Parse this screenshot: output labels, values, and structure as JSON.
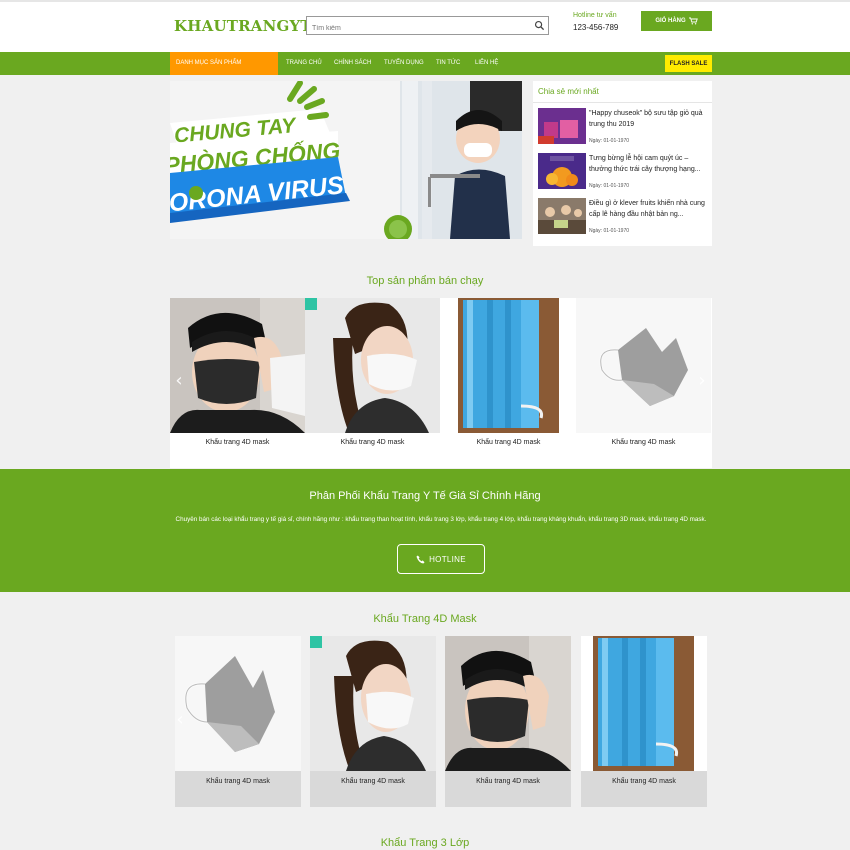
{
  "header": {
    "logo": "KHAUTRANGYTE",
    "search_placeholder": "Tìm kiếm",
    "hotline_label": "Hotline tư vấn",
    "hotline_number": "123-456-789",
    "cart_label": "GIỎ HÀNG"
  },
  "nav": {
    "category_label": "DANH MỤC SẢN PHẨM",
    "items": [
      "TRANG CHỦ",
      "CHÍNH SÁCH",
      "TUYỂN DỤNG",
      "TIN TỨC",
      "LIÊN HỆ"
    ],
    "flash_sale": "FLASH SALE"
  },
  "banner": {
    "line1": "CHUNG TAY",
    "line2": "PHÒNG CHỐNG",
    "line3": "CORONA VIRUS"
  },
  "news": {
    "title": "Chia sẻ mới nhất",
    "items": [
      {
        "title": "\"Happy chuseok\" bộ sưu tập giỏ quà trung thu 2019",
        "date": "Ngày: 01-01-1970"
      },
      {
        "title": "Tưng bừng lễ hội cam quýt úc – thưởng thức trái cây thượng hạng...",
        "date": "Ngày: 01-01-1970"
      },
      {
        "title": "Điều gì ở klever fruits khiến nhà cung cấp lê hàng đầu nhật bản ng...",
        "date": "Ngày: 01-01-1970"
      }
    ]
  },
  "bestsellers": {
    "title": "Top sản phẩm bán chạy",
    "products": [
      {
        "name": "Khẩu trang 4D mask",
        "image": "black-mask-person"
      },
      {
        "name": "Khẩu trang 4D mask",
        "image": "white-mask-woman"
      },
      {
        "name": "Khẩu trang 4D mask",
        "image": "blue-surgical-mask"
      },
      {
        "name": "Khẩu trang 4D mask",
        "image": "gray-4d-mask"
      }
    ]
  },
  "promo": {
    "title": "Phân Phối Khẩu Trang Y Tế Giá Sỉ Chính Hãng",
    "text": "Chuyên bán các loại khẩu trang y tế giá sỉ, chính hãng như : khẩu trang than hoạt tính, khẩu trang 3 lớp, khẩu trang 4 lớp, khẩu trang kháng khuẩn, khẩu trang 3D mask, khẩu trang 4D mask.",
    "button": "HOTLINE"
  },
  "section_4d": {
    "title": "Khẩu Trang 4D Mask",
    "products": [
      {
        "name": "Khẩu trang 4D mask",
        "image": "gray-4d-mask"
      },
      {
        "name": "Khẩu trang 4D mask",
        "image": "white-mask-woman"
      },
      {
        "name": "Khẩu trang 4D mask",
        "image": "black-mask-person"
      },
      {
        "name": "Khẩu trang 4D mask",
        "image": "blue-surgical-mask"
      }
    ]
  },
  "section_3lop": {
    "title": "Khẩu Trang 3 Lớp"
  },
  "colors": {
    "brand_green": "#6aa820",
    "category_orange": "#ff9800",
    "flash_yellow": "#ffeb00"
  }
}
